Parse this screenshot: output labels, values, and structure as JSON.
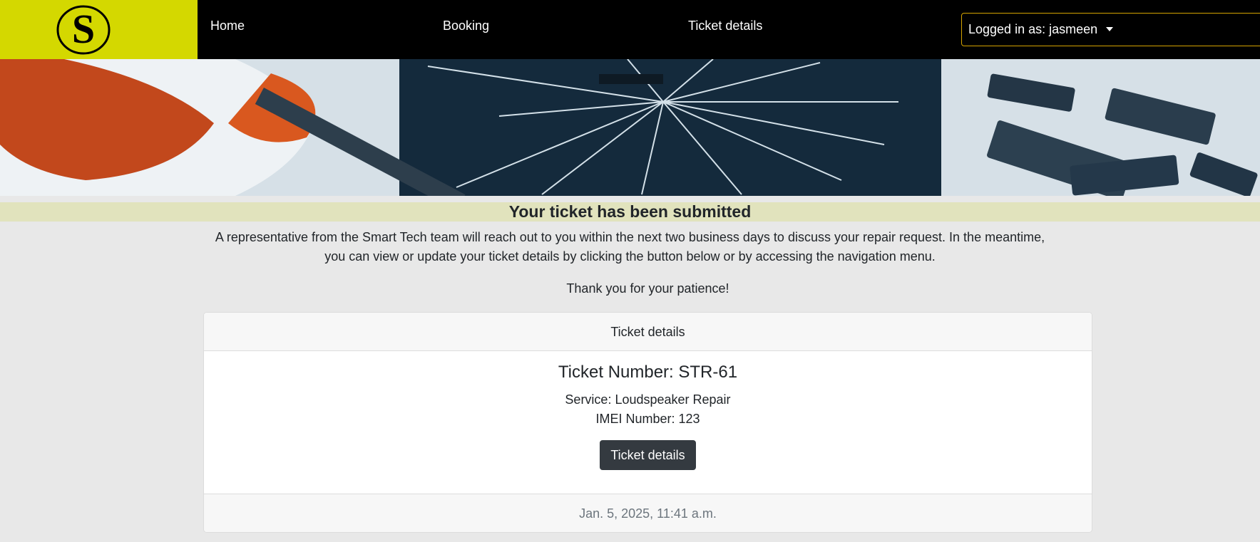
{
  "nav": {
    "logo_letter": "S",
    "home": "Home",
    "booking": "Booking",
    "ticket_details": "Ticket details",
    "user_menu": "Logged in as: jasmeen"
  },
  "hero": {
    "image_subject": "broken-phone-repair-icon"
  },
  "confirmation": {
    "heading": "Your ticket has been submitted",
    "intro": "A representative from the Smart Tech team will reach out to you within the next two business days to discuss your repair request. In the meantime, you can view or update your ticket details by clicking the button below or by accessing the navigation menu.",
    "thanks": "Thank you for your patience!"
  },
  "ticket_card": {
    "header": "Ticket details",
    "ticket_number": "Ticket Number: STR-61",
    "service": "Service: Loudspeaker Repair",
    "imei": "IMEI Number: 123",
    "button_label": "Ticket details",
    "timestamp": "Jan. 5, 2025, 11:41 a.m."
  },
  "colors": {
    "brand_yellow": "#d4d800",
    "navbar": "#000000",
    "heading_band": "#e1e3bd",
    "page_background": "#e8e8e8",
    "button_dark": "#343a40"
  }
}
